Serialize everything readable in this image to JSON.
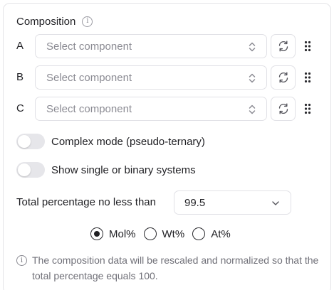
{
  "composition": {
    "title": "Composition",
    "info_icon": "info-icon",
    "components": [
      {
        "label": "A",
        "placeholder": "Select component",
        "refresh_icon": "refresh-icon",
        "drag_icon": "drag-handle-icon"
      },
      {
        "label": "B",
        "placeholder": "Select component",
        "refresh_icon": "refresh-icon",
        "drag_icon": "drag-handle-icon"
      },
      {
        "label": "C",
        "placeholder": "Select component",
        "refresh_icon": "refresh-icon",
        "drag_icon": "drag-handle-icon"
      }
    ]
  },
  "toggles": [
    {
      "label": "Complex mode (pseudo-ternary)",
      "on": false
    },
    {
      "label": "Show single or binary systems",
      "on": false
    }
  ],
  "total_percentage": {
    "label": "Total percentage no less than",
    "value": "99.5"
  },
  "units": {
    "options": [
      {
        "label": "Mol%",
        "checked": true
      },
      {
        "label": "Wt%",
        "checked": false
      },
      {
        "label": "At%",
        "checked": false
      }
    ]
  },
  "note": {
    "icon": "info-icon",
    "text": "The composition data will be rescaled and normalized so that the total percentage equals 100."
  },
  "colors": {
    "border": "#e4e4e7",
    "placeholder": "#8b8b93",
    "toggle_off": "#e6e6ea",
    "text": "#1f1f23",
    "muted": "#707078"
  }
}
